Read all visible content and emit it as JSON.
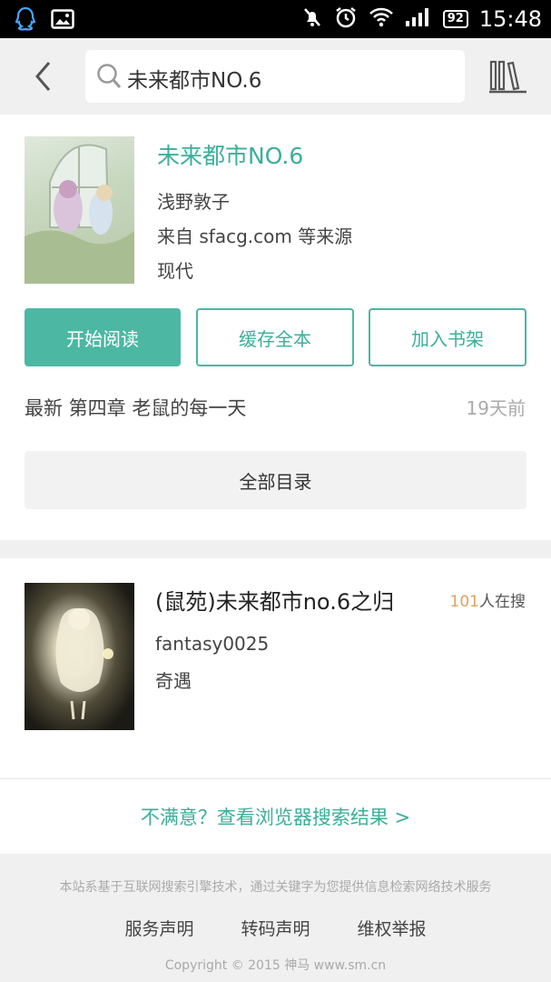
{
  "status_bar": {
    "time": "15:48",
    "battery": "92",
    "icons": [
      "qq-icon",
      "image-icon",
      "mute-icon",
      "alarm-icon",
      "wifi-icon",
      "signal-icon"
    ]
  },
  "toolbar": {
    "search_text": "未来都市NO.6"
  },
  "result1": {
    "title": "未来都市NO.6",
    "author": "浅野敦子",
    "source": "来自 sfacg.com 等来源",
    "genre": "现代",
    "btn_read": "开始阅读",
    "btn_cache": "缓存全本",
    "btn_shelf": "加入书架",
    "latest": "最新 第四章 老鼠的每一天",
    "latest_time": "19天前",
    "catalog": "全部目录"
  },
  "result2": {
    "title": "(鼠苑)未来都市no.6之归",
    "hot_count": "101",
    "hot_label": "人在搜",
    "author": "fantasy0025",
    "genre": "奇遇"
  },
  "web_link": "不满意？查看浏览器搜索结果 >",
  "footer": {
    "description": "本站系基于互联网搜索引擎技术，通过关键字为您提供信息检索网络技术服务",
    "links": [
      "服务声明",
      "转码声明",
      "维权举报"
    ],
    "copyright": "Copyright © 2015 神马 www.sm.cn"
  },
  "colors": {
    "accent": "#4cb8a4",
    "accent_text": "#3aaf9a",
    "hot_number": "#e0a060",
    "toolbar_bg": "#f0f0f0"
  }
}
